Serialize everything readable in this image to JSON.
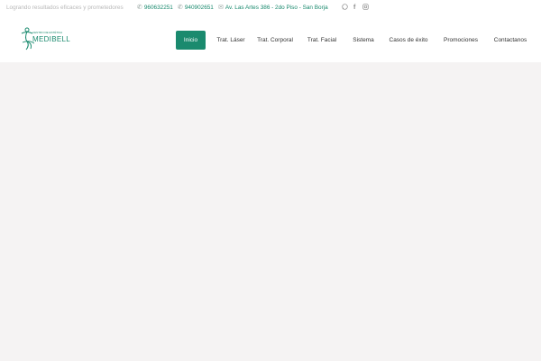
{
  "topbar": {
    "tagline": "Logrando resultados eficaces y prometedores",
    "phone1": "960632251",
    "phone2": "940902651",
    "address": "Av. Las Artes 386 - 2do Piso - San Borja",
    "icons": [
      "phone-icon",
      "phone-icon",
      "mail-icon",
      "whatsapp-icon",
      "facebook-icon",
      "instagram-icon"
    ]
  },
  "logo": {
    "brand": "MEDIBELL",
    "sub": "CENTRO DE ESTÉTICA"
  },
  "nav": {
    "items": [
      "Inicio",
      "Trat. Láser",
      "Trat. Corporal",
      "Trat. Facial",
      "Sistema",
      "Casos de éxito",
      "Promociones",
      "Contactanos"
    ],
    "active": "Inicio"
  },
  "colors": {
    "accent": "#1a8a6e",
    "page_bg": "#f5f3f3",
    "header_bg": "#ffffff"
  }
}
